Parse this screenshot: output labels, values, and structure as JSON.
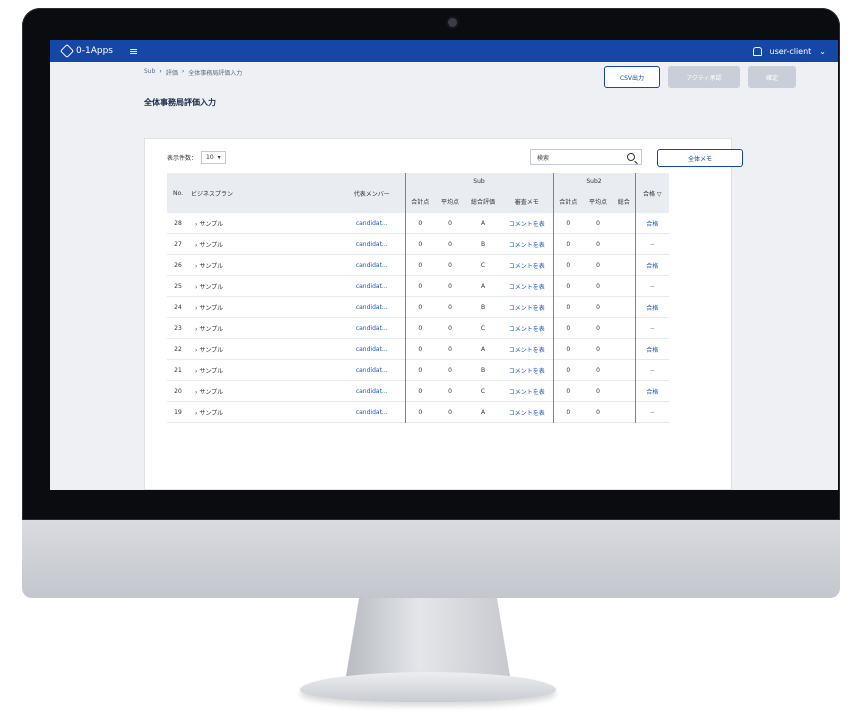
{
  "topbar": {
    "app_name": "0-1Apps",
    "user": "user-client"
  },
  "breadcrumb": [
    "Sub",
    "評価",
    "全体事務局評価入力"
  ],
  "page": {
    "title": "全体事務局評価入力"
  },
  "actions": {
    "csv_label": "CSV出力",
    "disabled1_label": "アクティ承認",
    "disabled2_label": "確定"
  },
  "toolbar": {
    "per_page_label": "表示件数：",
    "per_page_value": "10",
    "search_value": "検索",
    "memo_button": "全体メモ"
  },
  "table": {
    "group_headers": [
      "Sub",
      "Sub2"
    ],
    "columns": {
      "no": "No.",
      "business_plan": "ビジネスプラン",
      "member": "代表メンバー",
      "g1": [
        "合計点",
        "平均点",
        "総合評価",
        "審査メモ"
      ],
      "g2": [
        "合計点",
        "平均点",
        "総合"
      ],
      "status": "合格"
    },
    "rows": [
      {
        "no": "28",
        "plan": "サンプル",
        "member": "candidat...",
        "s1": "0",
        "a1": "0",
        "grade": "A",
        "memo": "コメントを表",
        "s2": "0",
        "a2": "0",
        "status": "合格"
      },
      {
        "no": "27",
        "plan": "サンプル",
        "member": "candidat...",
        "s1": "0",
        "a1": "0",
        "grade": "B",
        "memo": "コメントを表",
        "s2": "0",
        "a2": "0",
        "status": "−"
      },
      {
        "no": "26",
        "plan": "サンプル",
        "member": "candidat...",
        "s1": "0",
        "a1": "0",
        "grade": "C",
        "memo": "コメントを表",
        "s2": "0",
        "a2": "0",
        "status": "合格"
      },
      {
        "no": "25",
        "plan": "サンプル",
        "member": "candidat...",
        "s1": "0",
        "a1": "0",
        "grade": "A",
        "memo": "コメントを表",
        "s2": "0",
        "a2": "0",
        "status": "−"
      },
      {
        "no": "24",
        "plan": "サンプル",
        "member": "candidat...",
        "s1": "0",
        "a1": "0",
        "grade": "B",
        "memo": "コメントを表",
        "s2": "0",
        "a2": "0",
        "status": "合格"
      },
      {
        "no": "23",
        "plan": "サンプル",
        "member": "candidat...",
        "s1": "0",
        "a1": "0",
        "grade": "C",
        "memo": "コメントを表",
        "s2": "0",
        "a2": "0",
        "status": "−"
      },
      {
        "no": "22",
        "plan": "サンプル",
        "member": "candidat...",
        "s1": "0",
        "a1": "0",
        "grade": "A",
        "memo": "コメントを表",
        "s2": "0",
        "a2": "0",
        "status": "合格"
      },
      {
        "no": "21",
        "plan": "サンプル",
        "member": "candidat...",
        "s1": "0",
        "a1": "0",
        "grade": "B",
        "memo": "コメントを表",
        "s2": "0",
        "a2": "0",
        "status": "−"
      },
      {
        "no": "20",
        "plan": "サンプル",
        "member": "candidat...",
        "s1": "0",
        "a1": "0",
        "grade": "C",
        "memo": "コメントを表",
        "s2": "0",
        "a2": "0",
        "status": "合格"
      },
      {
        "no": "19",
        "plan": "サンプル",
        "member": "candidat...",
        "s1": "0",
        "a1": "0",
        "grade": "A",
        "memo": "コメントを表",
        "s2": "0",
        "a2": "0",
        "status": "−"
      }
    ]
  },
  "colors": {
    "brand": "#1747a6",
    "link": "#1a56c2",
    "disabled": "#c9ced8"
  }
}
